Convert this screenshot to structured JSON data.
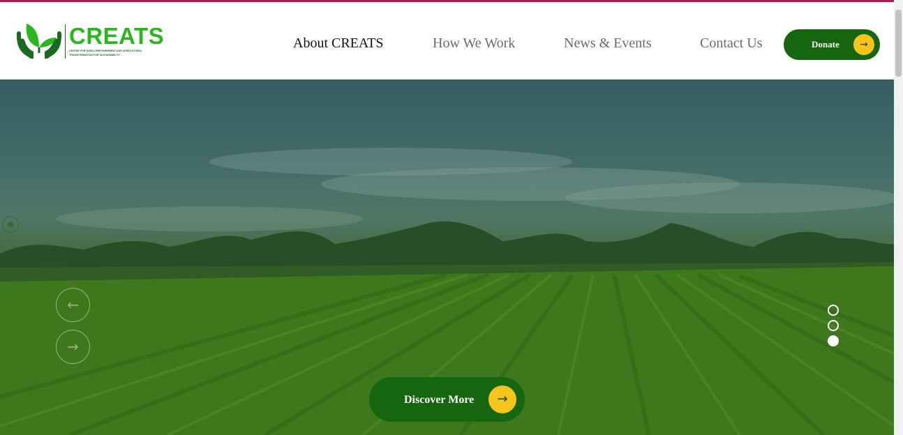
{
  "brand": {
    "name": "CREATS",
    "tagline": "Centre for Rural Empowerment and Agricultural Transformation for Sustainability",
    "logo_icon": "hands-leaf-icon",
    "color_primary": "#15660f",
    "color_logo": "#2bb51f",
    "color_accent": "#f6c51b",
    "color_topline": "#a51d4c"
  },
  "nav": {
    "items": [
      {
        "label": "About CREATS",
        "active": true
      },
      {
        "label": "How We Work",
        "active": false
      },
      {
        "label": "News & Events",
        "active": false
      },
      {
        "label": "Contact Us",
        "active": false
      }
    ],
    "donate_label": "Donate",
    "donate_icon": "arrow-right-icon"
  },
  "hero": {
    "image": "green crop field under a cloudy sky",
    "prev_icon": "arrow-left-icon",
    "next_icon": "arrow-right-icon",
    "play_icon": "circle-dot-icon",
    "slides_total": 3,
    "active_slide": 3,
    "cta_label": "Discover More",
    "cta_icon": "arrow-right-icon"
  }
}
